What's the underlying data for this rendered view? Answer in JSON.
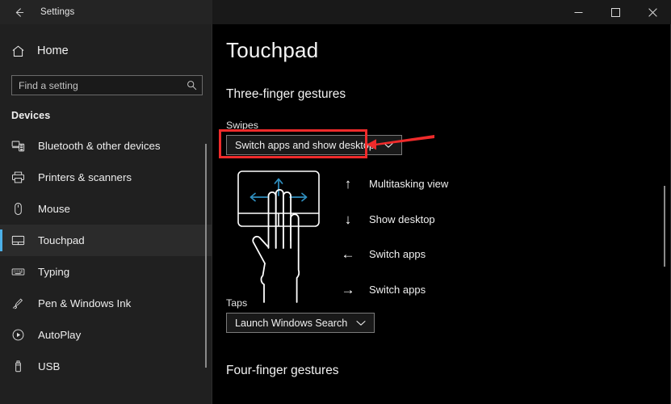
{
  "window": {
    "title": "Settings",
    "back_icon": "back-arrow-icon",
    "controls": [
      {
        "name": "minimize",
        "icon": "minimize-icon"
      },
      {
        "name": "maximize",
        "icon": "maximize-icon"
      },
      {
        "name": "close",
        "icon": "close-icon"
      }
    ]
  },
  "sidebar": {
    "home": {
      "label": "Home",
      "icon": "home-icon"
    },
    "search": {
      "placeholder": "Find a setting",
      "value": "",
      "icon": "search-icon"
    },
    "group_header": "Devices",
    "items": [
      {
        "label": "Bluetooth & other devices",
        "icon": "bluetooth-devices-icon",
        "selected": false
      },
      {
        "label": "Printers & scanners",
        "icon": "printer-icon",
        "selected": false
      },
      {
        "label": "Mouse",
        "icon": "mouse-icon",
        "selected": false
      },
      {
        "label": "Touchpad",
        "icon": "touchpad-icon",
        "selected": true
      },
      {
        "label": "Typing",
        "icon": "keyboard-icon",
        "selected": false
      },
      {
        "label": "Pen & Windows Ink",
        "icon": "pen-icon",
        "selected": false
      },
      {
        "label": "AutoPlay",
        "icon": "autoplay-icon",
        "selected": false
      },
      {
        "label": "USB",
        "icon": "usb-icon",
        "selected": false
      }
    ]
  },
  "main": {
    "page_title": "Touchpad",
    "section_title": "Three-finger gestures",
    "swipes": {
      "label": "Swipes",
      "value": "Switch apps and show desktop",
      "chevron_icon": "chevron-down-icon"
    },
    "illustration": {
      "name": "three-finger-swipe-illustration",
      "arrow_color": "#2f8fc0",
      "hand_color": "#ffffff"
    },
    "legend": [
      {
        "arrow": "↑",
        "arrow_name": "arrow-up-icon",
        "label": "Multitasking view"
      },
      {
        "arrow": "↓",
        "arrow_name": "arrow-down-icon",
        "label": "Show desktop"
      },
      {
        "arrow": "←",
        "arrow_name": "arrow-left-icon",
        "label": "Switch apps"
      },
      {
        "arrow": "→",
        "arrow_name": "arrow-right-icon",
        "label": "Switch apps"
      }
    ],
    "taps": {
      "label": "Taps",
      "value": "Launch Windows Search",
      "chevron_icon": "chevron-down-icon",
      "highlight_color": "#ef2b2b"
    },
    "next_section_title": "Four-finger gestures"
  },
  "colors": {
    "accent": "#4cb0e8",
    "sidebar_bg": "#202020",
    "main_bg": "#000000",
    "titlebar_bg": "#191919",
    "annotation_red": "#ef2b2b"
  }
}
